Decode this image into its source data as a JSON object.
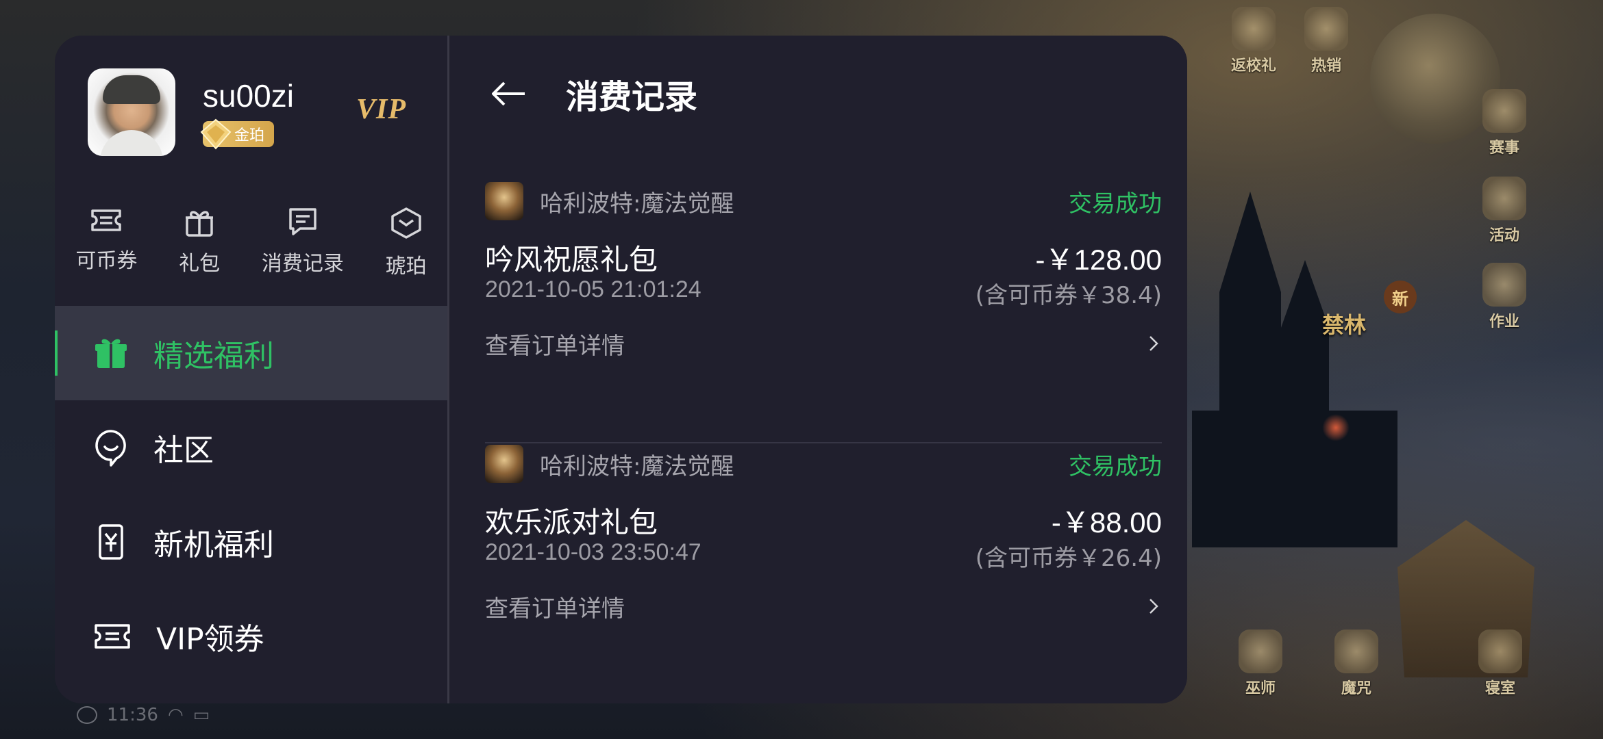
{
  "game_background": {
    "icons": [
      {
        "key": "return_gift",
        "label": "返校礼"
      },
      {
        "key": "hot",
        "label": "热销"
      },
      {
        "key": "match",
        "label": "赛事"
      },
      {
        "key": "activity",
        "label": "活动"
      },
      {
        "key": "homework",
        "label": "作业"
      },
      {
        "key": "wizard",
        "label": "巫师"
      },
      {
        "key": "spell",
        "label": "魔咒"
      },
      {
        "key": "dorm",
        "label": "寝室"
      }
    ],
    "new_badge": "新",
    "forest_label": "禁林",
    "time": "11:36"
  },
  "profile": {
    "username": "su00zi",
    "tier": "金珀",
    "vip": "VIP"
  },
  "quick_actions": [
    {
      "label": "可币券",
      "icon": "ticket-icon"
    },
    {
      "label": "礼包",
      "icon": "gift-icon"
    },
    {
      "label": "消费记录",
      "icon": "records-icon"
    },
    {
      "label": "琥珀",
      "icon": "amber-icon"
    }
  ],
  "menu": [
    {
      "label": "精选福利",
      "icon": "gift-icon",
      "active": true
    },
    {
      "label": "社区",
      "icon": "chat-bubble-icon",
      "active": false
    },
    {
      "label": "新机福利",
      "icon": "yen-phone-icon",
      "active": false
    },
    {
      "label": "VIP领券",
      "icon": "coupon-icon",
      "active": false
    }
  ],
  "header": {
    "title": "消费记录"
  },
  "orders": [
    {
      "game": "哈利波特:魔法觉醒",
      "status": "交易成功",
      "item": "吟风祝愿礼包",
      "price": "-￥128.00",
      "time": "2021-10-05 21:01:24",
      "coupon": "(含可币券￥38.4)",
      "detail": "查看订单详情"
    },
    {
      "game": "哈利波特:魔法觉醒",
      "status": "交易成功",
      "item": "欢乐派对礼包",
      "price": "-￥88.00",
      "time": "2021-10-03 23:50:47",
      "coupon": "(含可币券￥26.4)",
      "detail": "查看订单详情"
    }
  ],
  "colors": {
    "accent": "#2fc164",
    "vip_gold": "#e6bb6a",
    "panel": "#201f2d"
  }
}
